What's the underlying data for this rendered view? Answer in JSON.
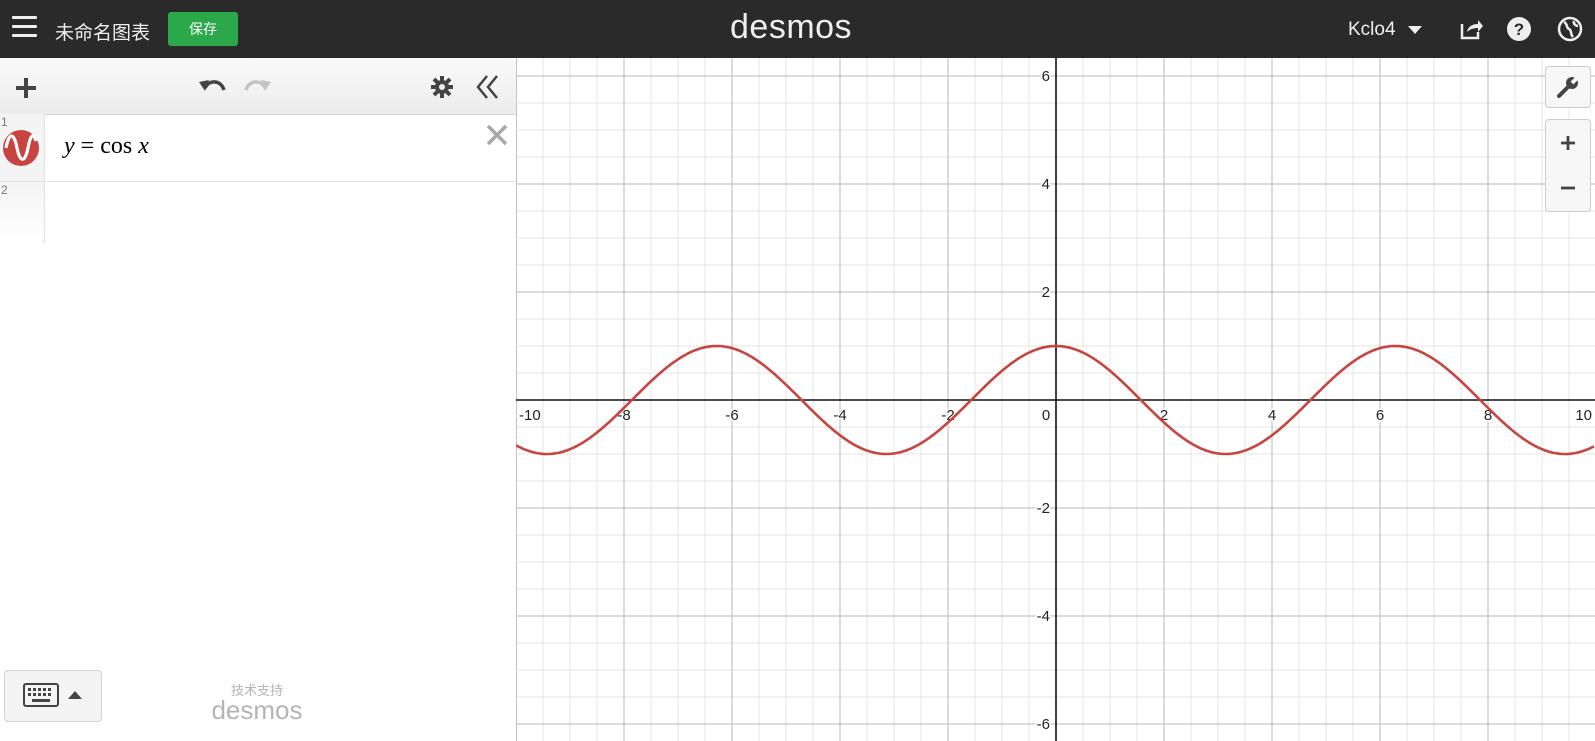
{
  "header": {
    "graph_title": "未命名图表",
    "save_label": "保存",
    "logo": "desmos",
    "username": "Kclo4"
  },
  "expressions": [
    {
      "index": "1",
      "latex_y": "y",
      "latex_eq": "=",
      "latex_fn": "cos",
      "latex_x": "x",
      "color": "#c74440"
    },
    {
      "index": "2"
    }
  ],
  "powered_by": {
    "text": "技术支持",
    "logo": "desmos"
  },
  "graph": {
    "curve_color": "#c74440",
    "x_range": [
      -10,
      10
    ],
    "y_range": [
      -6,
      6
    ],
    "x_ticks": [
      "-10",
      "-8",
      "-6",
      "-4",
      "-2",
      "0",
      "2",
      "4",
      "6",
      "8",
      "10"
    ],
    "y_ticks": [
      "6",
      "4",
      "2",
      "-2",
      "-4",
      "-6"
    ],
    "function": "cos(x)"
  },
  "icons": {
    "menu": "hamburger-menu-icon",
    "share": "share-icon",
    "help": "help-icon",
    "language": "globe-icon",
    "add": "plus-icon",
    "undo": "undo-icon",
    "redo": "redo-icon",
    "settings": "gear-icon",
    "collapse": "double-chevron-left-icon",
    "wrench": "wrench-icon",
    "zoom_in": "plus-icon",
    "zoom_out": "minus-icon",
    "keyboard": "keyboard-icon"
  }
}
